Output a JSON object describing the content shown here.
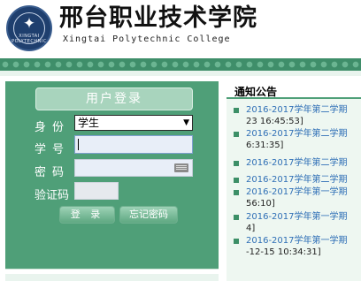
{
  "header": {
    "logo_text": "XINGTAI POLYTECHNIC",
    "college_name": "邢台职业技术学院",
    "college_name_en": "Xingtai Polytechnic College"
  },
  "login": {
    "title": "用户登录",
    "identity_label": "身份",
    "identity_value": "学生",
    "username_label": "学号",
    "password_label": "密码",
    "captcha_label": "验证码",
    "login_button": "登 录",
    "forgot_button": "忘记密码"
  },
  "notice": {
    "title": "通知公告",
    "items": [
      {
        "title": "2016-2017学年第二学期",
        "time": "23 16:45:53]"
      },
      {
        "title": "2016-2017学年第二学期",
        "time": "6:31:35]"
      },
      {
        "title": "2016-2017学年第二学期",
        "time": ""
      },
      {
        "title": "2016-2017学年第二学期",
        "time": ""
      },
      {
        "title": "2016-2017学年第一学期",
        "time": "56:10]"
      },
      {
        "title": "2016-2017学年第一学期",
        "time": "4]"
      },
      {
        "title": "2016-2017学年第一学期",
        "time": "-12-15 10:34:31]"
      }
    ]
  },
  "colors": {
    "panel_green": "#4f9f78",
    "link_blue": "#2f6fb6"
  }
}
